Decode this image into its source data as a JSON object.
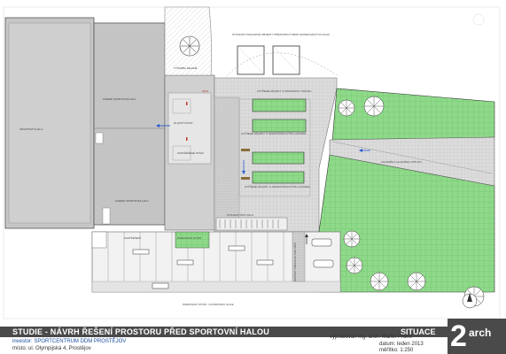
{
  "title": "STUDIE - NÁVRH ŘEŠENÍ PROSTORU PŘED SPORTOVNÍ HALOU",
  "sheet_name": "SITUACE",
  "investor": "investor: SPORTCENTRUM DDM PROSTĚJOV",
  "location": "místo: ul. Olympijská 4, Prostějov",
  "author": "vypracoval: Ing. arch. Martin Přůmi",
  "date": "datum: leden 2013",
  "scale": "měřítko: 1:250",
  "logo": {
    "number": "2",
    "word": "arch"
  },
  "labels": {
    "hall": "SPORTOVNÍ HALA",
    "hall_entrance_top": "ZÁZEMÍ SPORTOVNÍ HALY",
    "hall_entrance_bottom": "ZÁZEMÍ SPORTOVNÍ HALY",
    "existing_objects": "STÁVAJÍCÍ PLECHOVÉ OBJEKTY PŘESUNOUT MIMO NAVRHOVANÝ PLOCHU",
    "new_entrance": "HLAVNÍ VSTUP",
    "bench_area": "ZASTŘEŠENÉ STÁNÍ",
    "planters_top": "ZVÝŠENÉ ZÁHONY S OKRASNOU TRÁVOU",
    "planters_mid": "ZVÝŠENÉ ZÁHONY S ODDPOČINKOVÝMI LAVICEMI",
    "planters_bottom": "ZVÝŠENÉ ZÁHONY S ODDPOČINKOVÝMI LAVICEMI",
    "tree_area": "VÝSADBA ZELENĚ",
    "footpath": "CHODNÍK K HLAVNÍMU VSTUPU",
    "parking_top": "ZASTŘEŠENÍ",
    "bike_stands": "STOJANY PRO KOLA",
    "parking": "PARKOVACÍ STÁNÍ",
    "parking_street": "PARKOVACÍ STÁNÍ - OLYMPIJSKÁ ULICE",
    "crossing": "SNÍŽENÝ PŘECHOD PRO PĚŠÍ",
    "info": "INFO"
  },
  "colors": {
    "grass": "#8fd98a",
    "grass_grid": "#5fbf5a",
    "paving": "#d9d9d9",
    "building": "#c4c4c4",
    "asphalt": "#e8e8e8",
    "title_bar": "#4a4a4a"
  }
}
